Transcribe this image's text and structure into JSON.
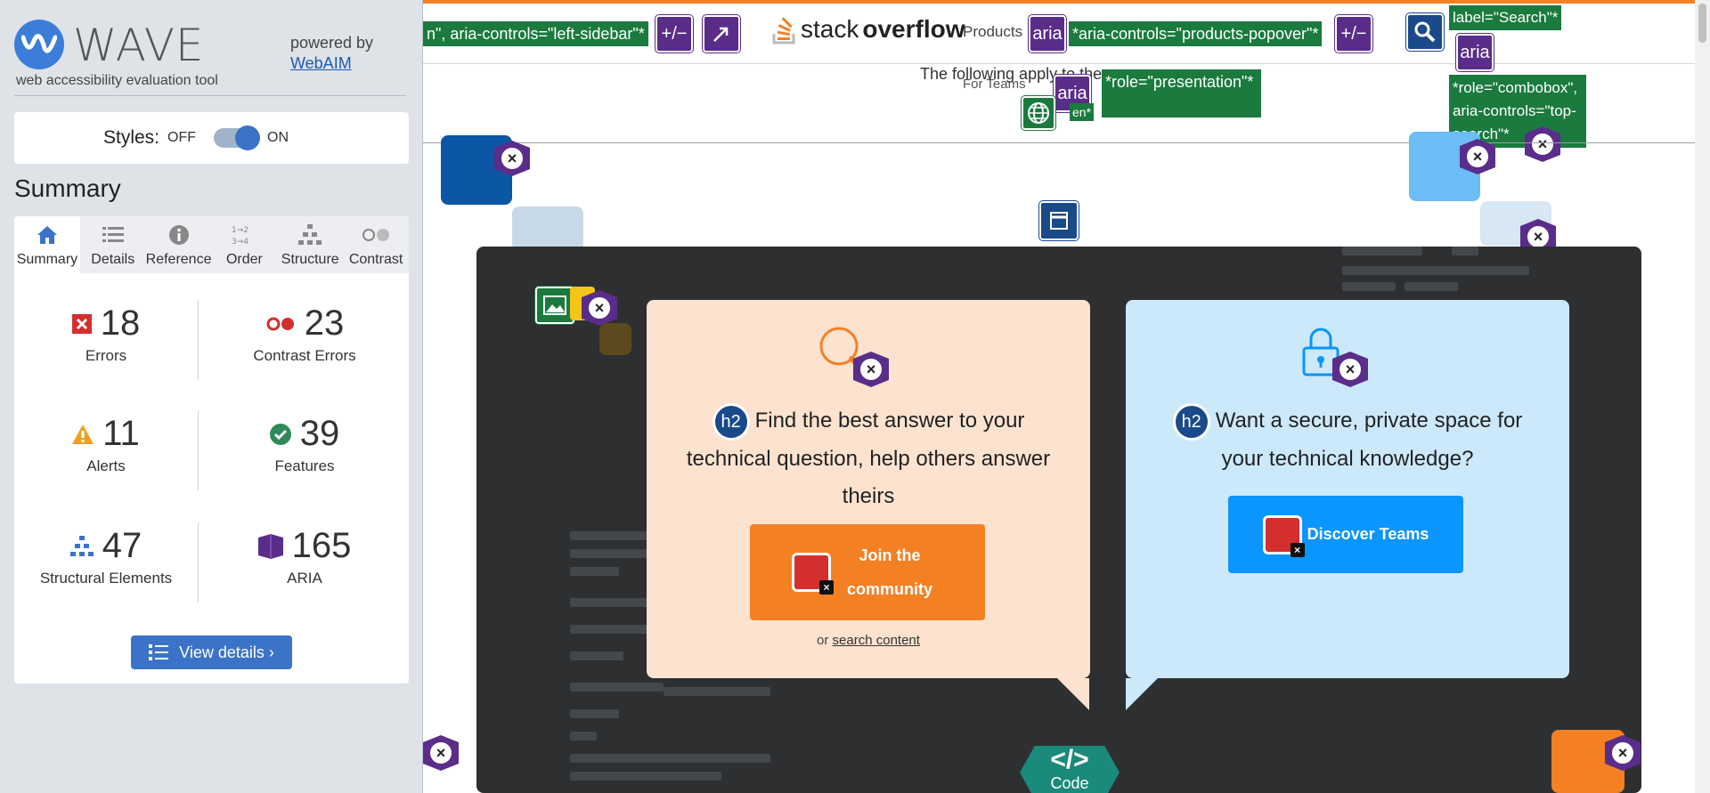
{
  "wave": {
    "logo_word": "WAVE",
    "tagline": "web accessibility evaluation tool",
    "powered_by": "powered by",
    "webaim_link": "WebAIM",
    "styles_label": "Styles:",
    "styles_off": "OFF",
    "styles_on": "ON",
    "styles_enabled": true,
    "summary_title": "Summary",
    "tabs": [
      {
        "label": "Summary",
        "icon": "home-icon"
      },
      {
        "label": "Details",
        "icon": "list-icon"
      },
      {
        "label": "Reference",
        "icon": "info-icon"
      },
      {
        "label": "Order",
        "icon": "order-icon"
      },
      {
        "label": "Structure",
        "icon": "structure-icon"
      },
      {
        "label": "Contrast",
        "icon": "contrast-icon"
      }
    ],
    "active_tab": "Summary",
    "stats": {
      "errors": {
        "value": "18",
        "label": "Errors",
        "color": "#d32f2f"
      },
      "contrast": {
        "value": "23",
        "label": "Contrast Errors",
        "color": "#d32f2f"
      },
      "alerts": {
        "value": "11",
        "label": "Alerts",
        "color": "#f0a020"
      },
      "features": {
        "value": "39",
        "label": "Features",
        "color": "#2e8b57"
      },
      "structure": {
        "value": "47",
        "label": "Structural Elements",
        "color": "#3b73c8"
      },
      "aria": {
        "value": "165",
        "label": "ARIA",
        "color": "#5a2d8a"
      }
    },
    "view_details": "View details ›"
  },
  "page": {
    "aria_left_sidebar": "n\", aria-controls=\"left-sidebar\"*",
    "plus_minus_1": "+/−",
    "logo_stack": "stack",
    "logo_overflow": "overflow",
    "products": "Products",
    "aria_badge": "aria",
    "aria_products_popover": "*aria-controls=\"products-popover\"*",
    "plus_minus_2": "+/−",
    "label_search": "label=\"Search\"*",
    "role_combobox": "*role=\"combobox\", aria-controls=\"top-search\"*",
    "following_apply": "The following apply to the",
    "for_teams": "For Teams",
    "role_presentation": "*role=\"presentation\"*",
    "en_fragment": "en*",
    "card1_heading_badge": "h2",
    "card1_heading": "Find the best answer to your technical question, help others answer theirs",
    "card1_cta": "Join the community",
    "card1_or": "or",
    "card1_link": "search content",
    "card2_heading_badge": "h2",
    "card2_heading": "Want a secure, private space for your technical knowledge?",
    "card2_cta": "Discover Teams",
    "code_symbol": "</>",
    "code_label": "Code"
  },
  "colors": {
    "wave_sidebar_bg": "#dfe3e8",
    "wave_blue": "#3b73c8",
    "aria_green": "#1b7a3e",
    "aria_purple": "#5a2d8a",
    "so_orange": "#f48024",
    "so_blue": "#0a95ff",
    "card_peach": "#fde3cf",
    "card_blue": "#cce9fb",
    "dark_card": "#2d2f31"
  }
}
